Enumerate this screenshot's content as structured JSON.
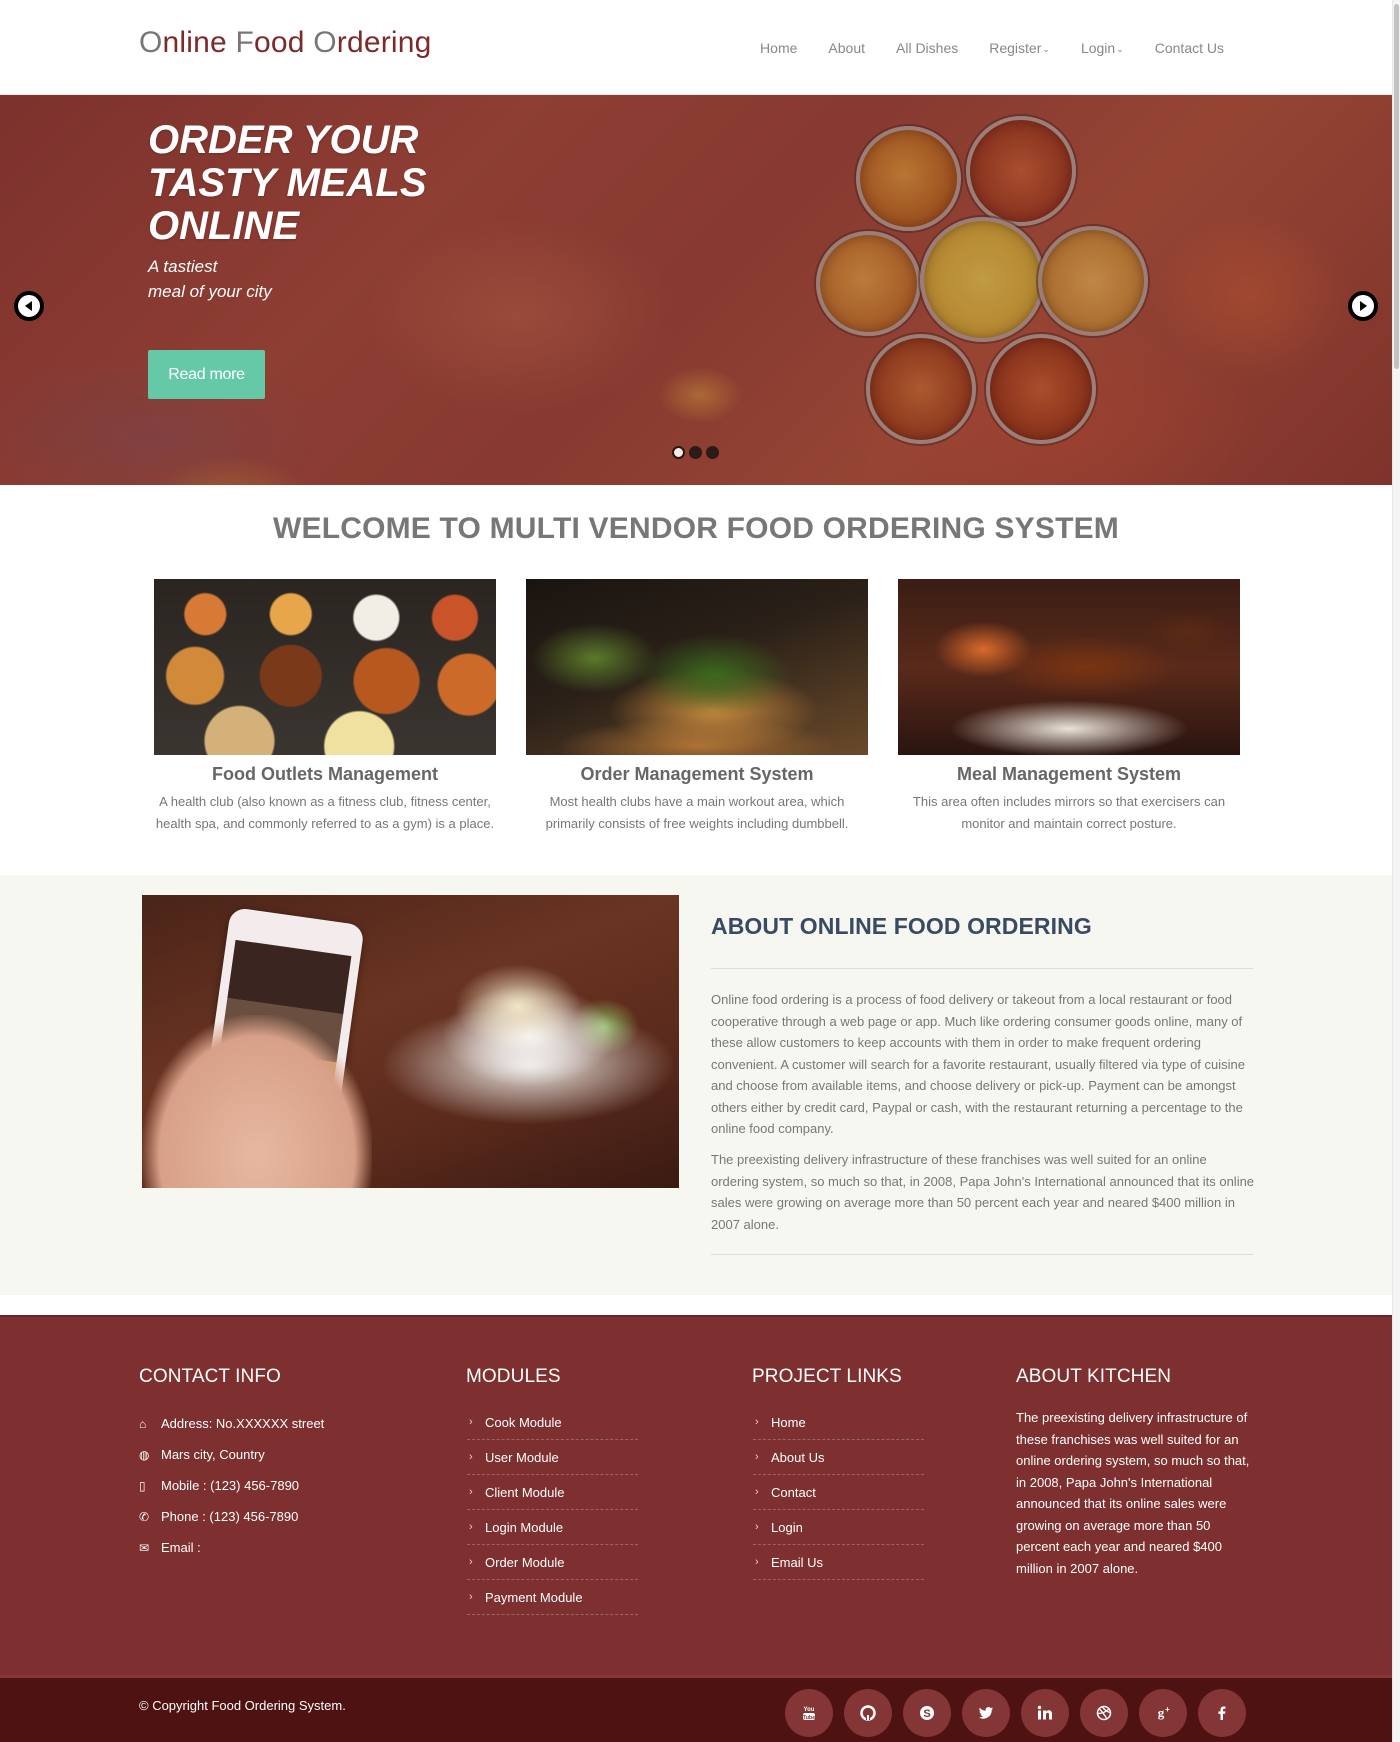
{
  "header": {
    "logo": {
      "part1_initial": "O",
      "part1_rest": "nline ",
      "part2_initial": "F",
      "part2_rest": "ood ",
      "part3_initial": "O",
      "part3_rest": "rdering"
    },
    "nav": [
      {
        "label": "Home",
        "has_dropdown": false
      },
      {
        "label": "About",
        "has_dropdown": false
      },
      {
        "label": "All Dishes",
        "has_dropdown": false
      },
      {
        "label": "Register",
        "has_dropdown": true
      },
      {
        "label": "Login",
        "has_dropdown": true
      },
      {
        "label": "Contact Us",
        "has_dropdown": false
      }
    ],
    "dropdown_caret": "⌄"
  },
  "hero": {
    "title": "ORDER YOUR TASTY MEALS ONLINE",
    "subtitle_line1": "A tastiest",
    "subtitle_line2": "meal of your city",
    "button_label": "Read more",
    "slide_count": 3,
    "active_slide": 1,
    "prev_icon": "arrow-left-circle",
    "next_icon": "arrow-right-circle"
  },
  "welcome": {
    "title": "WELCOME TO MULTI VENDOR FOOD ORDERING SYSTEM",
    "features": [
      {
        "title": "Food Outlets Management",
        "description": "A health club (also known as a fitness club, fitness center, health spa, and commonly referred to as a gym) is a place."
      },
      {
        "title": "Order Management System",
        "description": "Most health clubs have a main workout area, which primarily consists of free weights including dumbbell."
      },
      {
        "title": "Meal Management System",
        "description": "This area often includes mirrors so that exercisers can monitor and maintain correct posture."
      }
    ]
  },
  "about": {
    "heading": "ABOUT ONLINE FOOD ORDERING",
    "paragraph1": "Online food ordering is a process of food delivery or takeout from a local restaurant or food cooperative through a web page or app. Much like ordering consumer goods online, many of these allow customers to keep accounts with them in order to make frequent ordering convenient. A customer will search for a favorite restaurant, usually filtered via type of cuisine and choose from available items, and choose delivery or pick-up. Payment can be amongst others either by credit card, Paypal or cash, with the restaurant returning a percentage to the online food company.",
    "paragraph2": "The preexisting delivery infrastructure of these franchises was well suited for an online ordering system, so much so that, in 2008, Papa John's International announced that its online sales were growing on average more than 50 percent each year and neared $400 million in 2007 alone."
  },
  "footer": {
    "contact": {
      "heading": "CONTACT INFO",
      "items": [
        {
          "icon": "home-icon",
          "glyph": "⌂",
          "text": "Address: No.XXXXXX street"
        },
        {
          "icon": "globe-icon",
          "glyph": "◍",
          "text": "Mars city, Country"
        },
        {
          "icon": "mobile-icon",
          "glyph": "▯",
          "text": "Mobile : (123) 456-7890"
        },
        {
          "icon": "phone-icon",
          "glyph": "✆",
          "text": "Phone : (123) 456-7890"
        },
        {
          "icon": "envelope-icon",
          "glyph": "✉",
          "text": "Email :"
        }
      ]
    },
    "modules": {
      "heading": "MODULES",
      "items": [
        "Cook Module",
        "User Module",
        "Client Module",
        "Login Module",
        "Order Module",
        "Payment Module"
      ]
    },
    "project_links": {
      "heading": "PROJECT LINKS",
      "items": [
        "Home",
        "About Us",
        "Contact",
        "Login",
        "Email Us"
      ]
    },
    "kitchen": {
      "heading": "ABOUT KITCHEN",
      "text": "The preexisting delivery infrastructure of these franchises was well suited for an online ordering system, so much so that, in 2008, Papa John's International announced that its online sales were growing on average more than 50 percent each year and neared $400 million in 2007 alone."
    },
    "chevron": "›",
    "copyright": "© Copyright Food Ordering System.",
    "socials": [
      {
        "name": "youtube",
        "glyph": "You\nTube"
      },
      {
        "name": "github",
        "glyph": ""
      },
      {
        "name": "skype",
        "glyph": "S"
      },
      {
        "name": "twitter",
        "glyph": ""
      },
      {
        "name": "linkedin",
        "glyph": "in"
      },
      {
        "name": "dribbble",
        "glyph": ""
      },
      {
        "name": "google-plus",
        "glyph": "g+"
      },
      {
        "name": "facebook",
        "glyph": "f"
      }
    ]
  },
  "colors": {
    "brand": "#7d2a2b",
    "footer_bg": "#7e2f2f",
    "bottom_bar_bg": "#4f1212",
    "accent_button": "#65c9a8",
    "about_heading": "#3b4a63"
  }
}
